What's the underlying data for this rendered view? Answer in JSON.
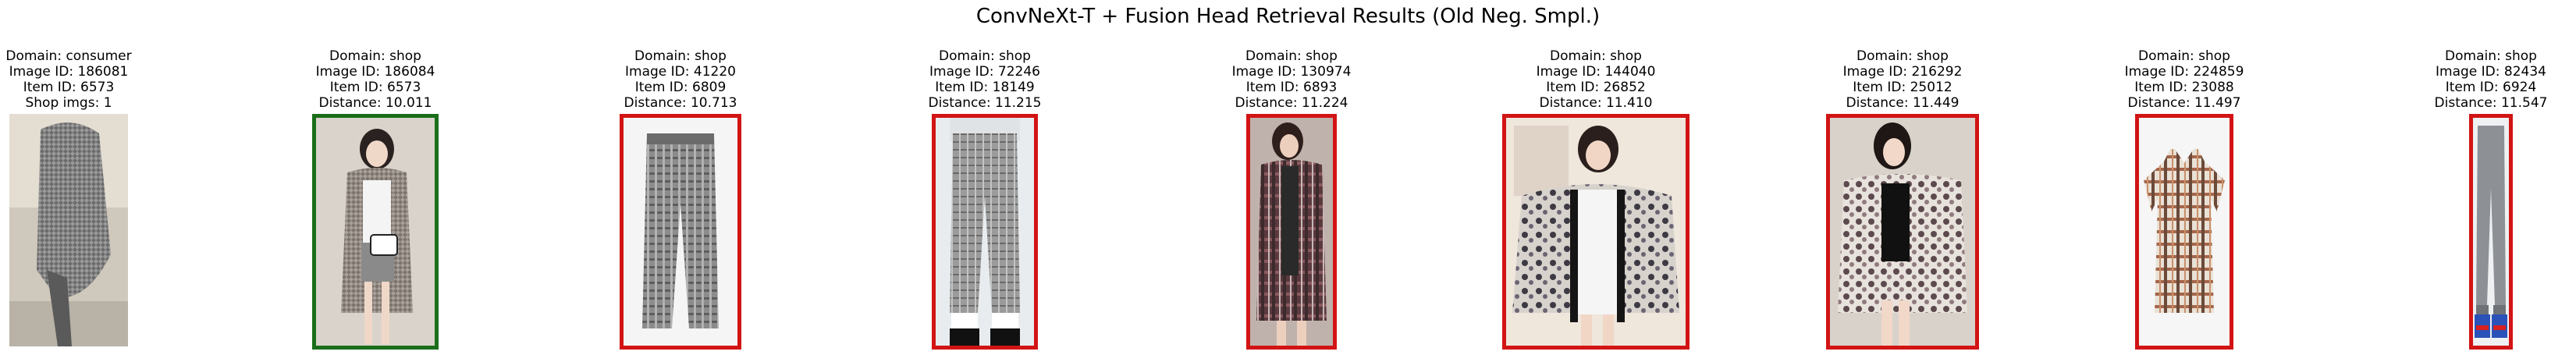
{
  "title": "ConvNeXt-T + Fusion Head Retrieval Results (Old Neg. Smpl.)",
  "colors": {
    "match_border": "#1a6e1a",
    "miss_border": "#d21414"
  },
  "panels": [
    {
      "kind": "query",
      "domain": "Domain: consumer",
      "image_id": "Image ID: 186081",
      "item_id": "Item ID: 6573",
      "extra": "Shop imgs: 1",
      "image": "grey knit cardigan photo"
    },
    {
      "kind": "match",
      "domain": "Domain: shop",
      "image_id": "Image ID: 186084",
      "item_id": "Item ID: 6573",
      "extra": "Distance: 10.011",
      "image": "woman in long cardigan"
    },
    {
      "kind": "miss",
      "domain": "Domain: shop",
      "image_id": "Image ID: 41220",
      "item_id": "Item ID: 6809",
      "extra": "Distance: 10.713",
      "image": "plaid trousers"
    },
    {
      "kind": "miss",
      "domain": "Domain: shop",
      "image_id": "Image ID: 72246",
      "item_id": "Item ID: 18149",
      "extra": "Distance: 11.215",
      "image": "plaid trousers"
    },
    {
      "kind": "miss",
      "domain": "Domain: shop",
      "image_id": "Image ID: 130974",
      "item_id": "Item ID: 6893",
      "extra": "Distance: 11.224",
      "image": "plaid shirt"
    },
    {
      "kind": "miss",
      "domain": "Domain: shop",
      "image_id": "Image ID: 144040",
      "item_id": "Item ID: 26852",
      "extra": "Distance: 11.410",
      "image": "patterned kimono"
    },
    {
      "kind": "miss",
      "domain": "Domain: shop",
      "image_id": "Image ID: 216292",
      "item_id": "Item ID: 25012",
      "extra": "Distance: 11.449",
      "image": "floral kimono"
    },
    {
      "kind": "miss",
      "domain": "Domain: shop",
      "image_id": "Image ID: 224859",
      "item_id": "Item ID: 23088",
      "extra": "Distance: 11.497",
      "image": "plaid shirt dress"
    },
    {
      "kind": "miss",
      "domain": "Domain: shop",
      "image_id": "Image ID: 82434",
      "item_id": "Item ID: 6924",
      "extra": "Distance: 11.547",
      "image": "grey jogger pants"
    }
  ]
}
